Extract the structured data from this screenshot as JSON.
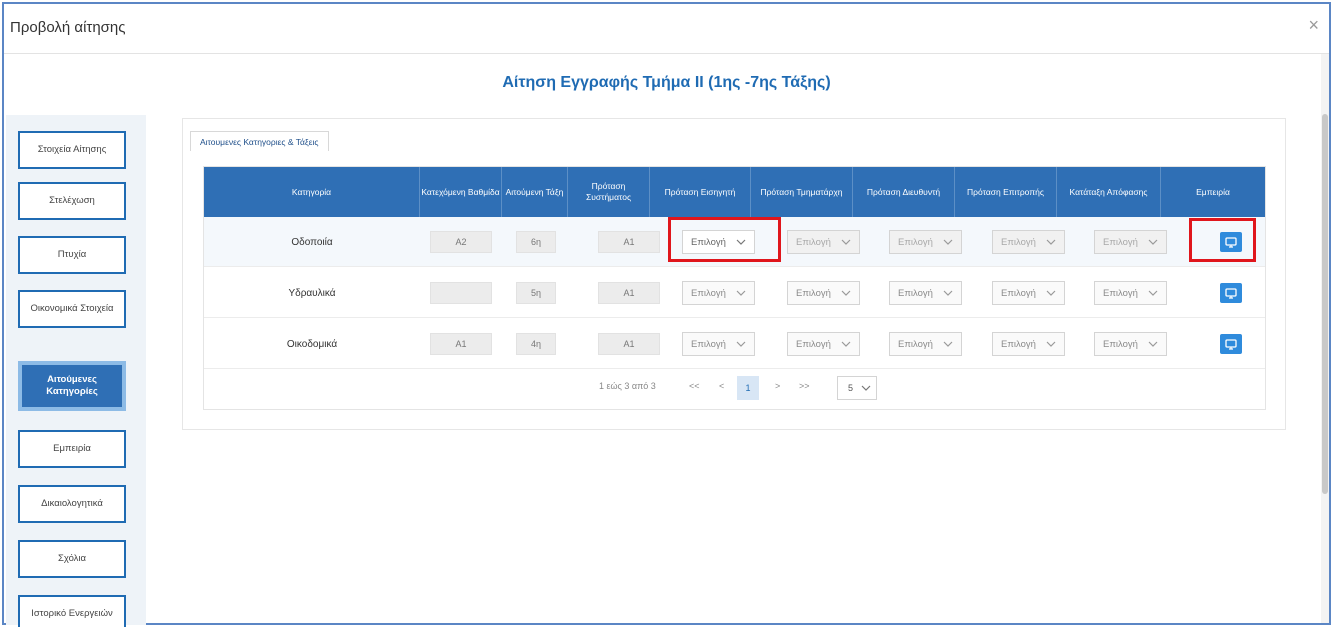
{
  "dialog": {
    "title": "Προβολή αίτησης",
    "close": "×"
  },
  "heading": "Αίτηση Εγγραφής Τμήμα ΙΙ (1ης -7ης Τάξης)",
  "sidebar": [
    {
      "label": "Στοιχεία Αίτησης",
      "active": false
    },
    {
      "label": "Στελέχωση",
      "active": false
    },
    {
      "label": "Πτυχία",
      "active": false
    },
    {
      "label": "Οικονομικά Στοιχεία",
      "active": false
    },
    {
      "label": "Αιτούμενες Κατηγορίες",
      "active": true
    },
    {
      "label": "Εμπειρία",
      "active": false
    },
    {
      "label": "Δικαιολογητικά",
      "active": false
    },
    {
      "label": "Σχόλια",
      "active": false
    },
    {
      "label": "Ιστορικό Ενεργειών",
      "active": false
    }
  ],
  "legend": "Αιτουμενες Κατηγοριες & Τάξεις",
  "table": {
    "headers": [
      "Κατηγορία",
      "Κατεχόμενη Βαθμίδα",
      "Αιτούμενη Τάξη",
      "Πρόταση Συστήματος",
      "Πρόταση Εισηγητή",
      "Πρόταση Τμηματάρχη",
      "Πρόταση Διευθυντή",
      "Πρόταση Επιτροπής",
      "Κατάταξη Απόφασης",
      "Εμπειρία"
    ],
    "select_placeholder": "Επιλογή",
    "rows": [
      {
        "category": "Οδοποιία",
        "grade": "Α2",
        "class": "6η",
        "system": "Α1"
      },
      {
        "category": "Υδραυλικά",
        "grade": "",
        "class": "5η",
        "system": "Α1"
      },
      {
        "category": "Οικοδομικά",
        "grade": "Α1",
        "class": "4η",
        "system": "Α1"
      }
    ]
  },
  "pager": {
    "summary": "1 εώς 3 από 3",
    "first": "<<",
    "prev": "<",
    "current": "1",
    "next": ">",
    "last": ">>",
    "page_size": "5"
  },
  "colors": {
    "primary": "#2f6fb5",
    "heading": "#1f6bb3",
    "highlight": "#e0161c",
    "button": "#2f8bdc"
  }
}
